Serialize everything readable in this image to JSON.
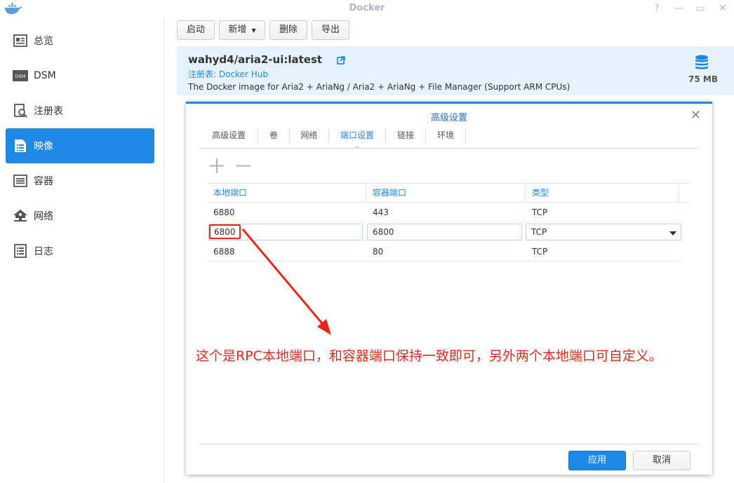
{
  "window": {
    "title": "Docker",
    "icon": "docker-whale-icon",
    "controls": [
      "help-icon",
      "minimize-icon",
      "maximize-icon",
      "close-icon"
    ]
  },
  "sidebar": {
    "items": [
      {
        "label": "总览",
        "icon": "overview-icon",
        "active": false
      },
      {
        "label": "DSM",
        "icon": "dsm-icon",
        "active": false
      },
      {
        "label": "注册表",
        "icon": "registry-icon",
        "active": false
      },
      {
        "label": "映像",
        "icon": "image-icon",
        "active": true
      },
      {
        "label": "容器",
        "icon": "container-icon",
        "active": false
      },
      {
        "label": "网络",
        "icon": "network-icon",
        "active": false
      },
      {
        "label": "日志",
        "icon": "log-icon",
        "active": false
      }
    ]
  },
  "toolbar": {
    "launch": "启动",
    "add": "新增",
    "delete": "删除",
    "export": "导出"
  },
  "image": {
    "name": "wahyd4/aria2-ui:latest",
    "registry": "注册表: Docker Hub",
    "description": "The Docker image for Aria2 + AriaNg / Aria2 + AriaNg + File Manager (Support ARM CPUs)",
    "size": "75 MB"
  },
  "dialog": {
    "title": "高级设置",
    "tabs": [
      {
        "label": "高级设置",
        "active": false
      },
      {
        "label": "卷",
        "active": false
      },
      {
        "label": "网络",
        "active": false
      },
      {
        "label": "端口设置",
        "active": true
      },
      {
        "label": "链接",
        "active": false
      },
      {
        "label": "环境",
        "active": false
      }
    ],
    "table": {
      "headers": [
        "本地端口",
        "容器端口",
        "类型"
      ],
      "rows": [
        {
          "local": "6880",
          "container": "443",
          "type": "TCP",
          "editing": false
        },
        {
          "local": "6800",
          "container": "6800",
          "type": "TCP",
          "editing": true
        },
        {
          "local": "6888",
          "container": "80",
          "type": "TCP",
          "editing": false
        }
      ]
    },
    "apply": "应用",
    "cancel": "取消"
  },
  "annotation": {
    "text": "这个是RPC本地端口，和容器端口保持一致即可，另外两个本地端口可自定义。",
    "color": "#e02a1f"
  },
  "colors": {
    "accent": "#1e88e5",
    "banner_bg": "#e6f2fb",
    "annotation": "#e02a1f"
  }
}
